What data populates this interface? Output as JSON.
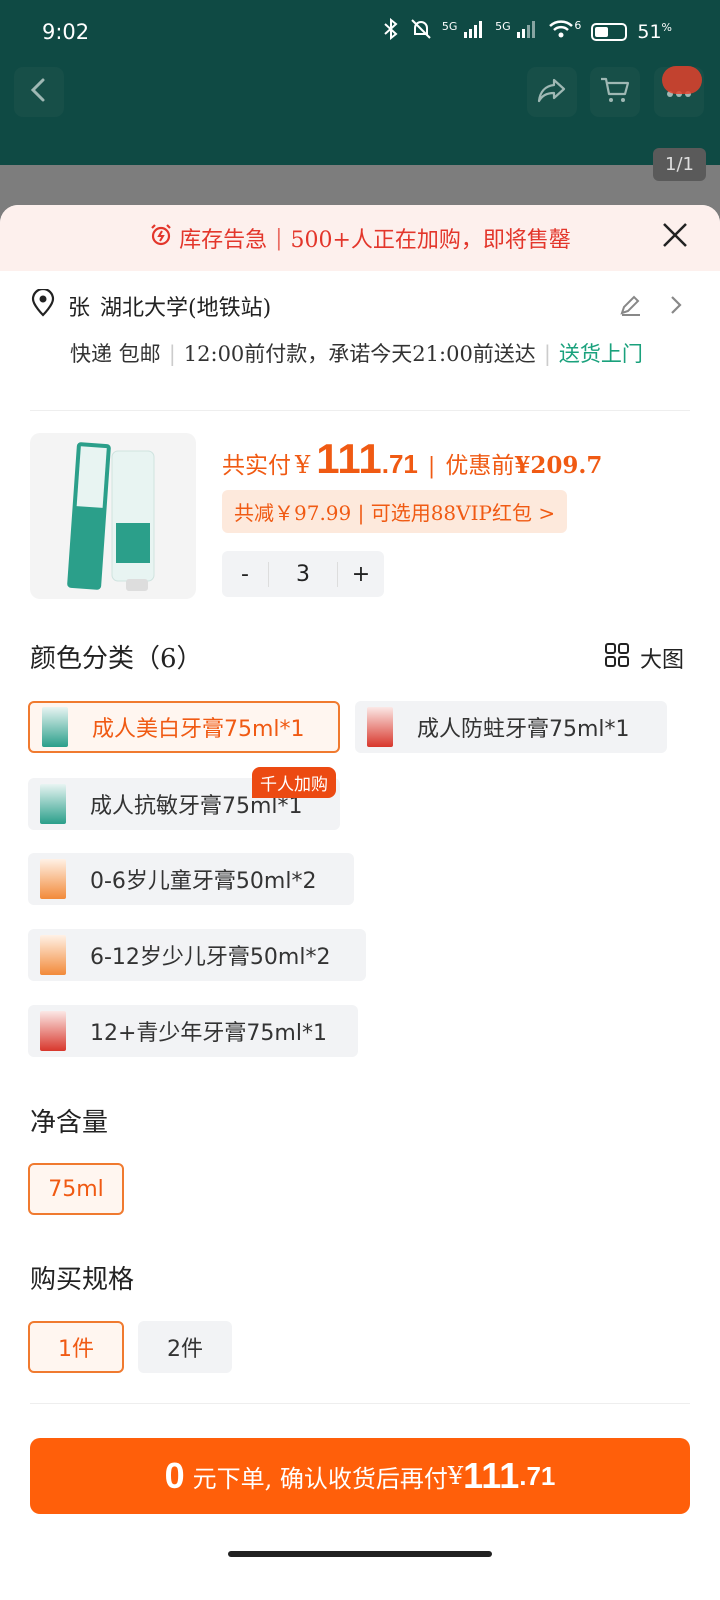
{
  "status_bar": {
    "time": "9:02",
    "signal1_label": "5G",
    "signal2_label": "5G",
    "wifi_label": "6",
    "battery_percent": "51",
    "battery_unit": "%"
  },
  "top_bar": {
    "image_counter": "1/1"
  },
  "alert": {
    "prefix": "库存告急",
    "message": "500+人正在加购，即将售罄"
  },
  "address": {
    "name": "张",
    "location": "湖北大学(地铁站)",
    "shipping": "快递 包邮",
    "promise": "12:00前付款，承诺今天21:00前送达",
    "door": "送货上门"
  },
  "product": {
    "pay_label": "共实付",
    "currency": "¥",
    "price_int": "111",
    "price_dec": ".71",
    "orig_label": "优惠前",
    "orig_price": "¥209.7",
    "discount_text": "共减￥97.99 | 可选用88VIP红包 >",
    "stepper": {
      "minus": "-",
      "qty": "3",
      "plus": "+"
    }
  },
  "color_section": {
    "title": "颜色分类（6）",
    "bigpic_label": "大图",
    "hot_badge": "千人加购",
    "options": [
      {
        "label": "成人美白牙膏75ml*1",
        "selected": true
      },
      {
        "label": "成人防蛀牙膏75ml*1",
        "selected": false
      },
      {
        "label": "成人抗敏牙膏75ml*1",
        "selected": false
      },
      {
        "label": "0-6岁儿童牙膏50ml*2",
        "selected": false
      },
      {
        "label": "6-12岁少儿牙膏50ml*2",
        "selected": false
      },
      {
        "label": "12+青少年牙膏75ml*1",
        "selected": false
      }
    ]
  },
  "volume_section": {
    "title": "净含量",
    "options": [
      {
        "label": "75ml",
        "selected": true
      }
    ]
  },
  "spec_section": {
    "title": "购买规格",
    "options": [
      {
        "label": "1件",
        "selected": true
      },
      {
        "label": "2件",
        "selected": false
      }
    ]
  },
  "cta": {
    "zero": "0",
    "middle": "元下单, 确认收货后再付",
    "currency": "¥",
    "amount_int": "111",
    "amount_dec": ".71"
  },
  "colors": {
    "accent": "#ff5f0a",
    "alert_red": "#e3362b",
    "green_link": "#1aa17c",
    "header_bg": "#0f4a44"
  }
}
